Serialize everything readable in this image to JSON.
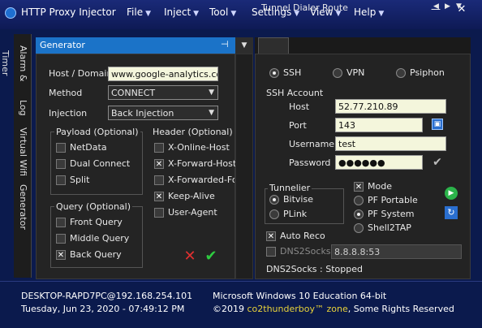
{
  "app": {
    "title": "HTTP Proxy Injector"
  },
  "menu": [
    {
      "label": "File"
    },
    {
      "label": "Inject"
    },
    {
      "label": "Tool"
    },
    {
      "label": "Settings"
    },
    {
      "label": "View"
    },
    {
      "label": "Help"
    }
  ],
  "side_tabs": [
    "Alarm & Timer",
    "Log",
    "Virtual Wifi",
    "Generator"
  ],
  "generator": {
    "title": "Generator",
    "host_label": "Host / Domain",
    "host_value": "www.google-analytics.com",
    "method_label": "Method",
    "method_value": "CONNECT",
    "injection_label": "Injection",
    "injection_value": "Back Injection",
    "payload_title": "Payload (Optional)",
    "payload_options": [
      {
        "label": "NetData",
        "checked": false
      },
      {
        "label": "Dual Connect",
        "checked": false
      },
      {
        "label": "Split",
        "checked": false
      }
    ],
    "header_title": "Header (Optional)",
    "header_options": [
      {
        "label": "X-Online-Host",
        "checked": false
      },
      {
        "label": "X-Forward-Host",
        "checked": true
      },
      {
        "label": "X-Forwarded-For",
        "checked": false
      },
      {
        "label": "Keep-Alive",
        "checked": true
      },
      {
        "label": "User-Agent",
        "checked": false
      }
    ],
    "query_title": "Query (Optional)",
    "query_options": [
      {
        "label": "Front Query",
        "checked": false
      },
      {
        "label": "Middle Query",
        "checked": false
      },
      {
        "label": "Back Query",
        "checked": true
      }
    ]
  },
  "right_tabs": [
    "Tunnel",
    "Dialer",
    "Route"
  ],
  "tunnel": {
    "modes": [
      {
        "label": "SSH",
        "selected": true
      },
      {
        "label": "VPN",
        "selected": false
      },
      {
        "label": "Psiphon",
        "selected": false
      }
    ],
    "ssh_account_title": "SSH Account",
    "host_label": "Host",
    "host_value": "52.77.210.89",
    "port_label": "Port",
    "port_value": "143",
    "username_label": "Username",
    "username_value": "test",
    "password_label": "Password",
    "password_value": "●●●●●●",
    "tunnelier_title": "Tunnelier",
    "tunneliers": [
      {
        "label": "Bitvise",
        "selected": true
      },
      {
        "label": "PLink",
        "selected": false
      }
    ],
    "mode_label": "Mode",
    "mode_checked": true,
    "mode_options": [
      {
        "label": "PF Portable",
        "selected": false
      },
      {
        "label": "PF System",
        "selected": true
      },
      {
        "label": "Shell2TAP",
        "selected": false
      }
    ],
    "auto_reco_label": "Auto Reco",
    "auto_reco_checked": true,
    "dns2socks_label": "DNS2Socks",
    "dns2socks_value": "8.8.8.8:53",
    "dns2socks_status": "DNS2Socks : Stopped"
  },
  "status": {
    "host": "DESKTOP-RAPD7PC@192.168.254.101",
    "datetime": "Tuesday, Jun 23, 2020 - 07:49:12 PM",
    "os": "Microsoft Windows 10 Education 64-bit",
    "copyright_prefix": "©2019",
    "copyright_brand": "co2thunderboy™ zone",
    "copyright_suffix": ", Some Rights Reserved"
  },
  "colors": {
    "accent": "#1b73c8",
    "brand": "#e8d23a",
    "background": "#0b1a4d"
  }
}
